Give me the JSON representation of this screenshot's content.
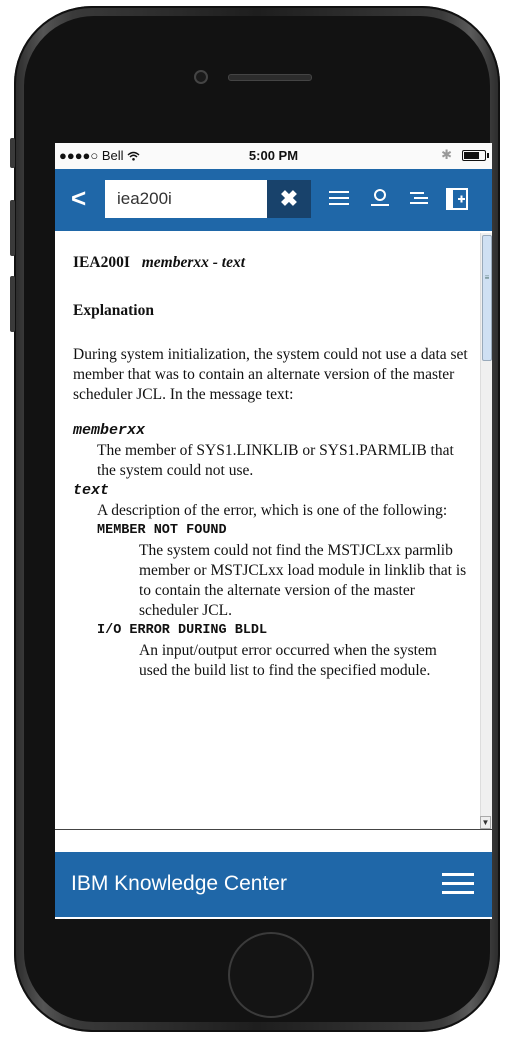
{
  "status_bar": {
    "carrier": "●●●●○ Bell",
    "time": "5:00 PM",
    "bluetooth": "✱"
  },
  "toolbar": {
    "back_glyph": "<",
    "search_value": "iea200i",
    "clear_glyph": "✖",
    "icons": [
      "toc-icon",
      "user-icon",
      "outline-icon",
      "add-collection-icon"
    ]
  },
  "content": {
    "message_id": "IEA200I",
    "message_vars": "memberxx - text",
    "explanation_heading": "Explanation",
    "explanation_text": "During system initialization, the system could not use a data set member that was to contain an alternate version of the master scheduler JCL. In the message text:",
    "terms": [
      {
        "term": "memberxx",
        "definition": "The member of SYS1.LINKLIB or SYS1.PARMLIB that the system could not use."
      },
      {
        "term": "text",
        "definition": "A description of the error, which is one of the following:",
        "subterms": [
          {
            "term": "MEMBER NOT FOUND",
            "definition": "The system could not find the MSTJCLxx parmlib member or MSTJCLxx load module in linklib that is to contain the alternate version of the master scheduler JCL."
          },
          {
            "term": "I/O ERROR DURING BLDL",
            "definition": "An input/output error occurred when the system used the build list to find the specified module."
          }
        ]
      }
    ]
  },
  "footer": {
    "title": "IBM Knowledge Center"
  },
  "colors": {
    "brand_blue": "#1f67a8",
    "clear_button": "#18426b"
  }
}
